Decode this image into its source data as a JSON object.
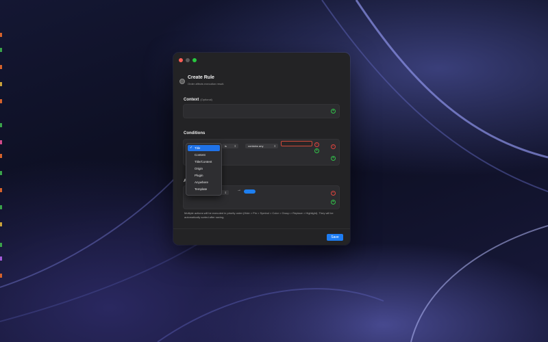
{
  "window": {
    "title": "Create Rule",
    "subtitle": "Order affects execution result."
  },
  "context": {
    "label": "Context",
    "optional_label": "(Optional)"
  },
  "conditions": {
    "label": "Conditions",
    "field_value": "Title",
    "operator_value": "is",
    "match_value": "contains any",
    "text_value": ""
  },
  "actions": {
    "label_visible": "A",
    "arrow": "→",
    "color": "#1e7ff0"
  },
  "note": "Multiple actions will be executed in priority order (Hide > Pin > Symbol > Color > Group > Replace > Highlight). They will be automatically sorted after saving.",
  "buttons": {
    "save": "Save"
  },
  "icons": {
    "plus": "+",
    "minus": "−"
  },
  "dropdown": {
    "check": "✓",
    "items": [
      "Title",
      "Content",
      "Title/Content",
      "Origin",
      "Plugin",
      "Anywhere",
      "Template"
    ],
    "selected": "Title"
  }
}
